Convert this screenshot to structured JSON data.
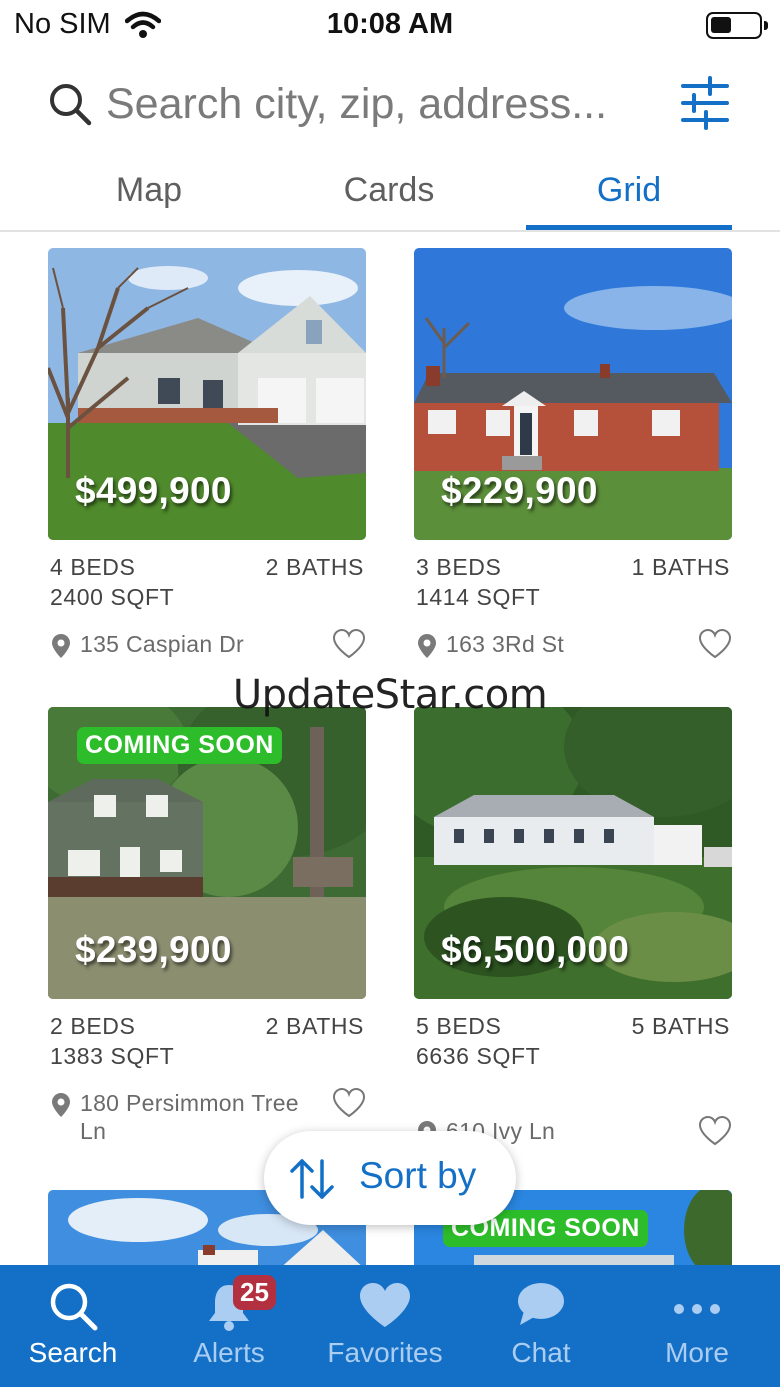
{
  "status_bar": {
    "carrier": "No SIM",
    "time": "10:08 AM"
  },
  "search": {
    "placeholder": "Search city, zip, address..."
  },
  "tabs": [
    {
      "label": "Map",
      "active": false
    },
    {
      "label": "Cards",
      "active": false
    },
    {
      "label": "Grid",
      "active": true
    }
  ],
  "listings": [
    {
      "price": "$499,900",
      "beds": "4 BEDS",
      "baths": "2 BATHS",
      "sqft": "2400 SQFT",
      "address": "135 Caspian Dr",
      "badge": ""
    },
    {
      "price": "$229,900",
      "beds": "3 BEDS",
      "baths": "1 BATHS",
      "sqft": "1414 SQFT",
      "address": "163 3Rd St",
      "badge": ""
    },
    {
      "price": "$239,900",
      "beds": "2 BEDS",
      "baths": "2 BATHS",
      "sqft": "1383 SQFT",
      "address": "180 Persimmon Tree Ln",
      "badge": "COMING SOON"
    },
    {
      "price": "$6,500,000",
      "beds": "5 BEDS",
      "baths": "5 BATHS",
      "sqft": "6636 SQFT",
      "address": "610 Ivy Ln",
      "badge": ""
    },
    {
      "badge": ""
    },
    {
      "badge": "COMING SOON"
    }
  ],
  "watermark": "UpdateStar.com",
  "sort": {
    "label": "Sort by"
  },
  "bottom_nav": [
    {
      "label": "Search",
      "icon": "search-icon",
      "active": true
    },
    {
      "label": "Alerts",
      "icon": "bell-icon",
      "badge": "25"
    },
    {
      "label": "Favorites",
      "icon": "heart-icon"
    },
    {
      "label": "Chat",
      "icon": "chat-bubble-icon"
    },
    {
      "label": "More",
      "icon": "more-dots-icon"
    }
  ],
  "colors": {
    "accent": "#1470c7",
    "badge_green": "#2dbd2a",
    "alert_badge": "#b33040"
  }
}
